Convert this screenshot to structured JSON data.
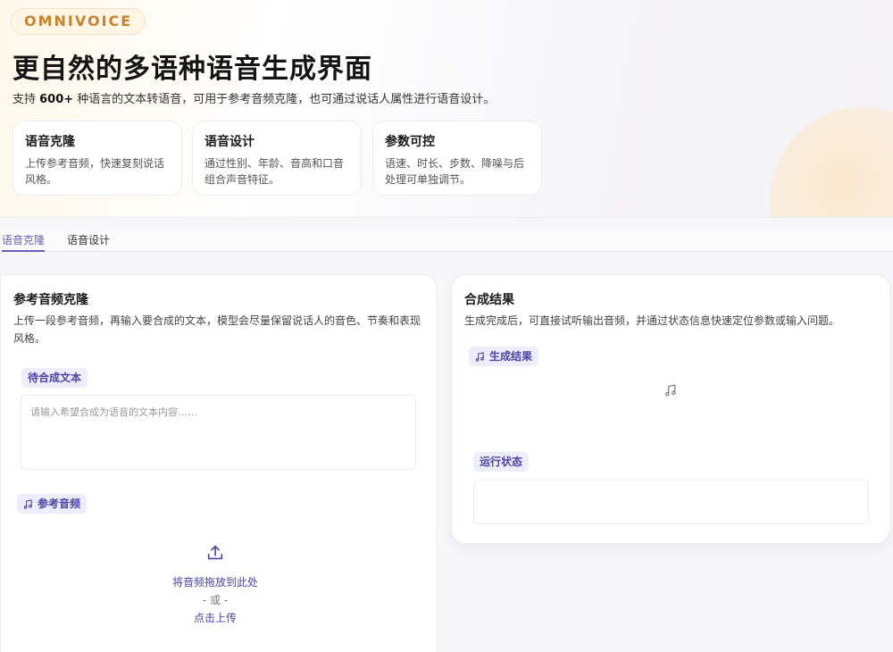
{
  "hero": {
    "badge": "OMNIVOICE",
    "title": "更自然的多语种语音生成界面",
    "subtitle_prefix": "支持 ",
    "subtitle_highlight": "600+",
    "subtitle_suffix": " 种语言的文本转语音，可用于参考音频克隆，也可通过说话人属性进行语音设计。",
    "features": [
      {
        "title": "语音克隆",
        "desc": "上传参考音频，快速复刻说话风格。"
      },
      {
        "title": "语音设计",
        "desc": "通过性别、年龄、音高和口音组合声音特征。"
      },
      {
        "title": "参数可控",
        "desc": "语速、时长、步数、降噪与后处理可单独调节。"
      }
    ]
  },
  "tabs": [
    {
      "label": "语音克隆",
      "active": true
    },
    {
      "label": "语音设计",
      "active": false
    }
  ],
  "clone_panel": {
    "title": "参考音频克隆",
    "desc": "上传一段参考音频，再输入要合成的文本，模型会尽量保留说话人的音色、节奏和表现风格。",
    "text_label": "待合成文本",
    "text_placeholder": "请输入希望合成为语音的文本内容……",
    "audio_label": "参考音频",
    "upload_drop": "将音频拖放到此处",
    "upload_or": "- 或 -",
    "upload_click": "点击上传",
    "icons": {
      "audio": "music-note-icon",
      "upload": "upload-icon"
    }
  },
  "result_panel": {
    "title": "合成结果",
    "desc": "生成完成后，可直接试听输出音频，并通过状态信息快速定位参数或输入问题。",
    "result_label": "生成结果",
    "status_label": "运行状态",
    "icons": {
      "result": "music-note-icon"
    }
  },
  "colors": {
    "accent": "#6a5fc1",
    "badge": "#c9822c",
    "chip_bg": "#eeedfb"
  }
}
